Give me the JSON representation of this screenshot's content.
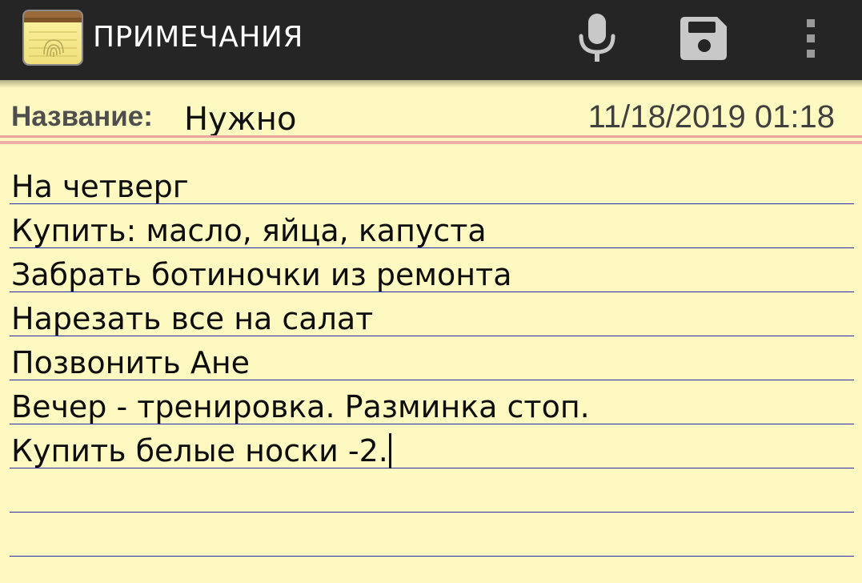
{
  "actionbar": {
    "title": "ПРИМЕЧАНИЯ",
    "icons": {
      "app": "notepad-fingerprint-icon",
      "mic": "microphone-icon",
      "save": "floppy-disk-icon",
      "menu": "overflow-menu-icon"
    },
    "background": "#252525",
    "icon_color": "#c8c8c8"
  },
  "note": {
    "title_label": "Название:",
    "title_value": "Нужно",
    "date": "11/18/2019 01:18",
    "lines": [
      "На четверг",
      "Купить: масло, яйца, капуста",
      "Забрать ботиночки из ремонта",
      "Нарезать все на салат",
      "Позвонить Ане",
      "Вечер - тренировка. Разминка стоп.",
      "Купить белые носки -2."
    ]
  },
  "colors": {
    "paper": "#fef9c0",
    "ruled_line": "#2a2aa8",
    "red_rule": "#e8a49c"
  }
}
